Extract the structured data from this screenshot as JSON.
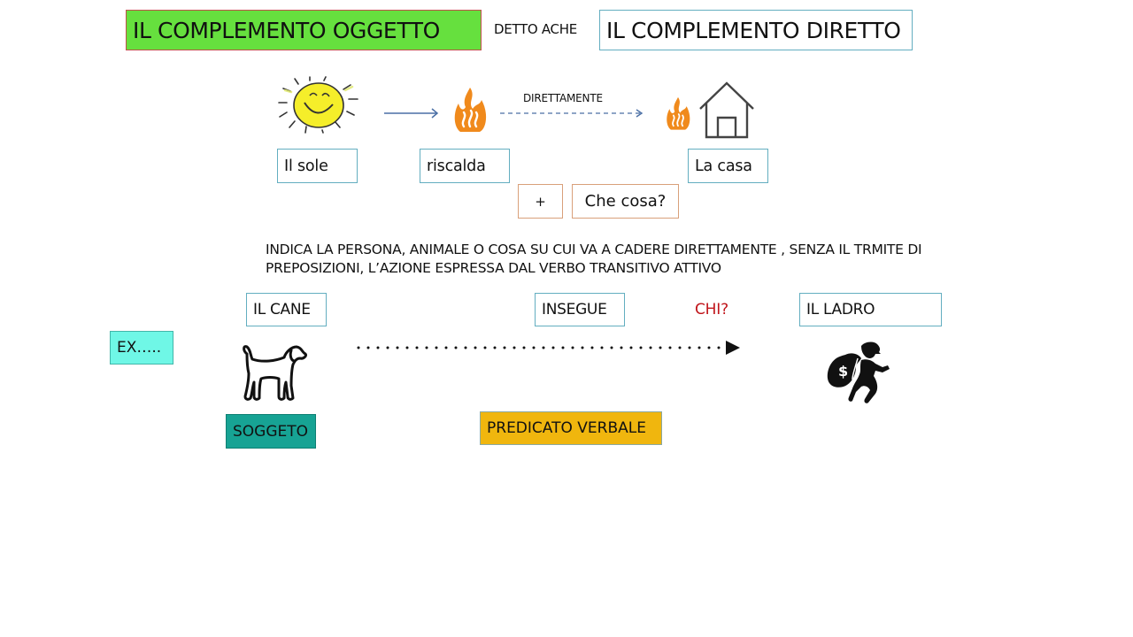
{
  "header": {
    "title_left": "IL COMPLEMENTO OGGETTO",
    "connector": "DETTO ACHE",
    "title_right": "IL COMPLEMENTO DIRETTO"
  },
  "example_top": {
    "icons": [
      "sun-icon",
      "fire-icon",
      "fire-icon",
      "house-icon"
    ],
    "subject": "Il sole",
    "verb": "riscalda",
    "arrow_label": "DIRETTAMENTE",
    "object": "La casa",
    "plus": "+",
    "question": "Che cosa?"
  },
  "definition": {
    "line1": "INDICA LA PERSONA, ANIMALE O COSA SU CUI VA A CADERE DIRETTAMENTE , SENZA IL TRMITE DI",
    "line2": "PREPOSIZIONI, L’AZIONE ESPRESSA DAL VERBO TRANSITIVO ATTIVO"
  },
  "example_bottom": {
    "ex_label": "EX…..",
    "subject": "IL CANE",
    "verb": "INSEGUE",
    "question": "CHI?",
    "object": "IL LADRO",
    "subject_role": "SOGGETO",
    "verb_role": "PREDICATO VERBALE",
    "icons": [
      "dog-icon",
      "thief-icon"
    ]
  },
  "colors": {
    "title_green": "#66e03e",
    "title_border_red": "#c0504d",
    "box_teal_border": "#63aec0",
    "box_orange_border": "#d9a07a",
    "question_red": "#c0151b",
    "ex_cyan": "#6ff7e6",
    "soggeto_teal": "#17a394",
    "predicato_gold": "#f0b60e",
    "fire_orange": "#f08a1c",
    "sun_yellow": "#f5ee2a"
  }
}
